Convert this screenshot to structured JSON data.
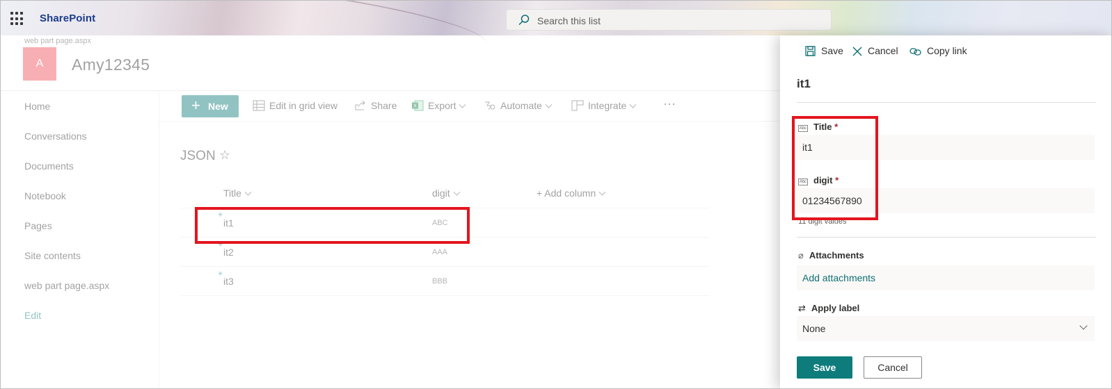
{
  "suite": {
    "brand": "SharePoint",
    "search_placeholder": "Search this list"
  },
  "site": {
    "breadcrumb": "web part page.aspx",
    "logo_letter": "A",
    "title": "Amy12345"
  },
  "nav": {
    "items": [
      "Home",
      "Conversations",
      "Documents",
      "Notebook",
      "Pages",
      "Site contents",
      "web part page.aspx"
    ],
    "edit": "Edit"
  },
  "commands": {
    "new": "New",
    "edit_grid": "Edit in grid view",
    "share": "Share",
    "export": "Export",
    "automate": "Automate",
    "integrate": "Integrate",
    "more": "···"
  },
  "list": {
    "title": "JSON",
    "columns": [
      "Title",
      "digit",
      "+ Add column"
    ],
    "rows": [
      {
        "title": "it1",
        "digit": "ABC"
      },
      {
        "title": "it2",
        "digit": "AAA"
      },
      {
        "title": "it3",
        "digit": "BBB"
      }
    ]
  },
  "panel": {
    "toolbar": {
      "save": "Save",
      "cancel": "Cancel",
      "copy_link": "Copy link"
    },
    "item_title": "it1",
    "fields": {
      "title_label": "Title",
      "title_value": "it1",
      "digit_label": "digit",
      "digit_value": "01234567890",
      "required_mark": "*",
      "digit_hint": "11 digit values",
      "attachments_label": "Attachments",
      "add_attachments": "Add attachments",
      "apply_label": "Apply label",
      "apply_value": "None",
      "abc_glyph": "Abc"
    },
    "buttons": {
      "save": "Save",
      "cancel": "Cancel"
    }
  },
  "colors": {
    "accent": "#0f7c7c",
    "highlight": "#e3151e",
    "brand": "#1b3a8a",
    "required": "#a4262c"
  }
}
